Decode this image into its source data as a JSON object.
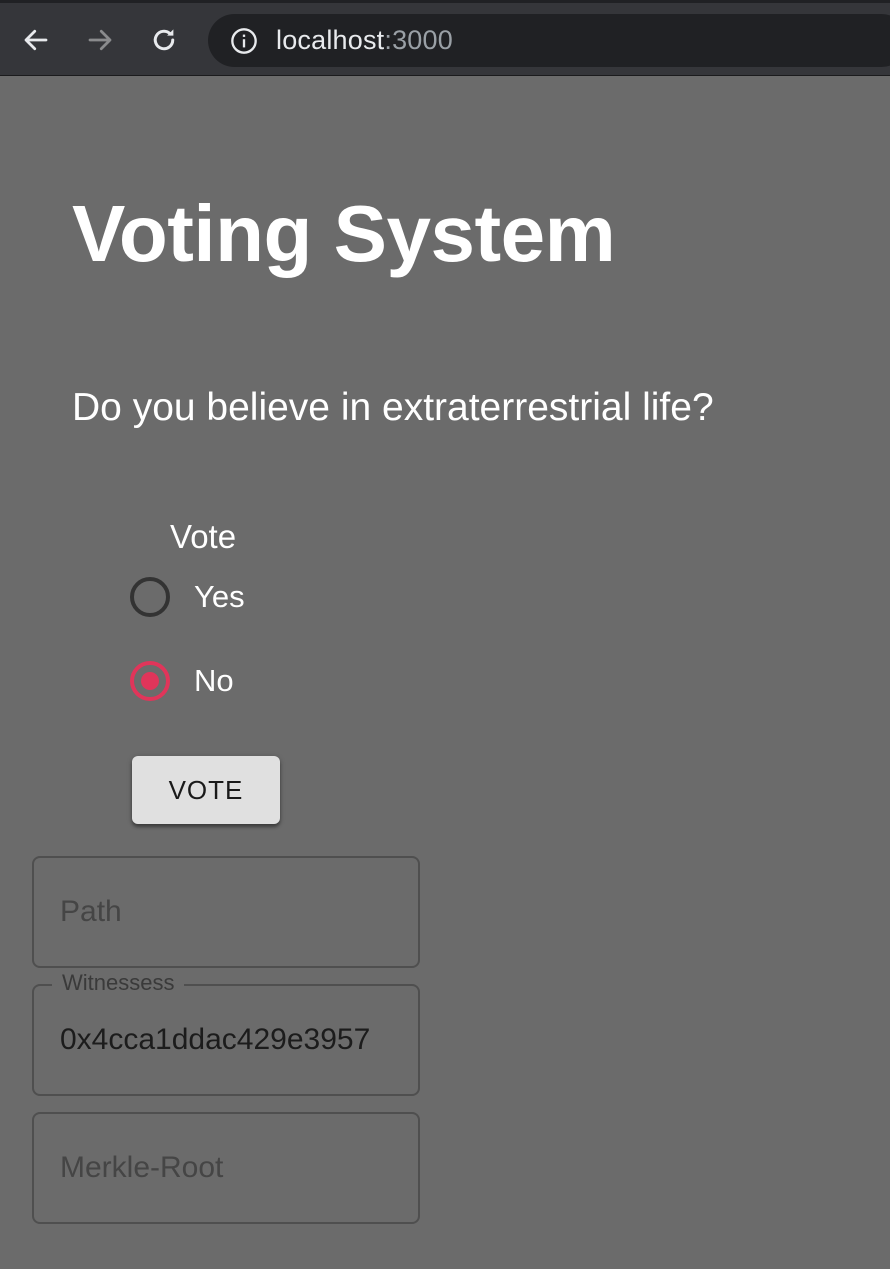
{
  "browser": {
    "url_host": "localhost",
    "url_port": ":3000",
    "icons": [
      "back-arrow-icon",
      "forward-arrow-icon",
      "reload-icon",
      "info-icon"
    ]
  },
  "page": {
    "title": "Voting System",
    "question": "Do you believe in extraterrestrial life?",
    "vote_legend": "Vote",
    "options": [
      {
        "label": "Yes",
        "checked": false
      },
      {
        "label": "No",
        "checked": true
      }
    ],
    "vote_button": "VOTE",
    "fields": {
      "path": {
        "placeholder": "Path",
        "value": ""
      },
      "witnesses": {
        "label": "Witnessess",
        "value": "0x4cca1ddac429e3957"
      },
      "merkle_root": {
        "placeholder": "Merkle-Root",
        "value": ""
      }
    },
    "colors": {
      "accent": "#e0355a",
      "background": "#6b6b6b",
      "toolbar": "#35363a"
    }
  }
}
